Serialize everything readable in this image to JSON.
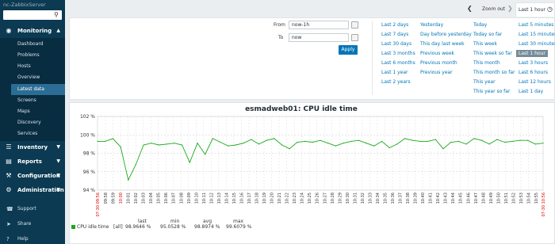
{
  "sidebar": {
    "brand": "nc-ZabbixServer",
    "sections": [
      {
        "label": "Monitoring",
        "icon": "eye-icon"
      },
      {
        "label": "Inventory",
        "icon": "list-icon"
      },
      {
        "label": "Reports",
        "icon": "report-icon"
      },
      {
        "label": "Configuration",
        "icon": "wrench-icon"
      },
      {
        "label": "Administration",
        "icon": "gear-icon"
      }
    ],
    "monitoring_items": [
      "Dashboard",
      "Problems",
      "Hosts",
      "Overview",
      "Latest data",
      "Screens",
      "Maps",
      "Discovery",
      "Services"
    ],
    "footer": [
      {
        "label": "Support",
        "icon": "headset-icon"
      },
      {
        "label": "Share",
        "icon": "share-icon"
      },
      {
        "label": "Help",
        "icon": "help-icon"
      }
    ]
  },
  "topbar": {
    "zoom_out": "Zoom out",
    "period_tab": "Last 1 hour"
  },
  "filter": {
    "from_label": "From",
    "from_value": "now-1h",
    "to_label": "To",
    "to_value": "now",
    "apply": "Apply",
    "quick": [
      [
        "Last 2 days",
        "Last 7 days",
        "Last 30 days",
        "Last 3 months",
        "Last 6 months",
        "Last 1 year",
        "Last 2 years"
      ],
      [
        "Yesterday",
        "Day before yesterday",
        "This day last week",
        "Previous week",
        "Previous month",
        "Previous year"
      ],
      [
        "Today",
        "Today so far",
        "This week",
        "This week so far",
        "This month",
        "This month so far",
        "This year",
        "This year so far"
      ],
      [
        "Last 5 minutes",
        "Last 15 minutes",
        "Last 30 minutes",
        "Last 1 hour",
        "Last 3 hours",
        "Last 6 hours",
        "Last 12 hours",
        "Last 1 day"
      ]
    ],
    "selected": "Last 1 hour"
  },
  "chart_data": {
    "type": "line",
    "title": "esmadweb01: CPU idle time",
    "ylim": [
      94,
      102
    ],
    "yticks": [
      "102 %",
      "100 %",
      "98 %",
      "96 %",
      "94 %"
    ],
    "start_label": "07-30 09:56",
    "end_label": "07-30 10:56",
    "xticks": [
      "09:58",
      "09:59",
      "10:00",
      "10:01",
      "10:02",
      "10:03",
      "10:04",
      "10:05",
      "10:06",
      "10:07",
      "10:08",
      "10:09",
      "10:10",
      "10:11",
      "10:12",
      "10:13",
      "10:14",
      "10:15",
      "10:16",
      "10:17",
      "10:18",
      "10:19",
      "10:20",
      "10:21",
      "10:22",
      "10:23",
      "10:24",
      "10:25",
      "10:26",
      "10:27",
      "10:28",
      "10:29",
      "10:30",
      "10:31",
      "10:32",
      "10:33",
      "10:34",
      "10:35",
      "10:36",
      "10:37",
      "10:38",
      "10:39",
      "10:40",
      "10:41",
      "10:42",
      "10:43",
      "10:44",
      "10:45",
      "10:46",
      "10:47",
      "10:48",
      "10:49",
      "10:50",
      "10:51",
      "10:52",
      "10:53",
      "10:54",
      "10:55"
    ],
    "red_xticks": [
      "10:00"
    ],
    "series": [
      {
        "name": "CPU idle time",
        "color": "#1aaa1a",
        "values": [
          99.3,
          99.3,
          99.6,
          98.7,
          95.1,
          96.8,
          98.9,
          99.1,
          98.9,
          99.0,
          99.1,
          98.9,
          97.0,
          99.1,
          97.9,
          99.6,
          99.2,
          98.8,
          98.9,
          99.1,
          99.5,
          99.0,
          99.4,
          99.6,
          98.9,
          98.5,
          99.2,
          99.3,
          99.2,
          99.4,
          99.1,
          98.8,
          99.1,
          99.3,
          99.4,
          99.1,
          98.8,
          99.3,
          98.6,
          99.0,
          99.6,
          99.4,
          99.3,
          99.3,
          99.5,
          98.5,
          99.2,
          99.3,
          99.0,
          99.6,
          99.4,
          99.0,
          99.5,
          99.2,
          99.3,
          99.4,
          99.4,
          99.0,
          99.1
        ]
      }
    ],
    "legend": {
      "name": "CPU idle time",
      "fn": "[all]",
      "headers": [
        "last",
        "min",
        "avg",
        "max"
      ],
      "values": [
        "98.9646 %",
        "95.0528 %",
        "98.8974 %",
        "99.6079 %"
      ]
    }
  }
}
